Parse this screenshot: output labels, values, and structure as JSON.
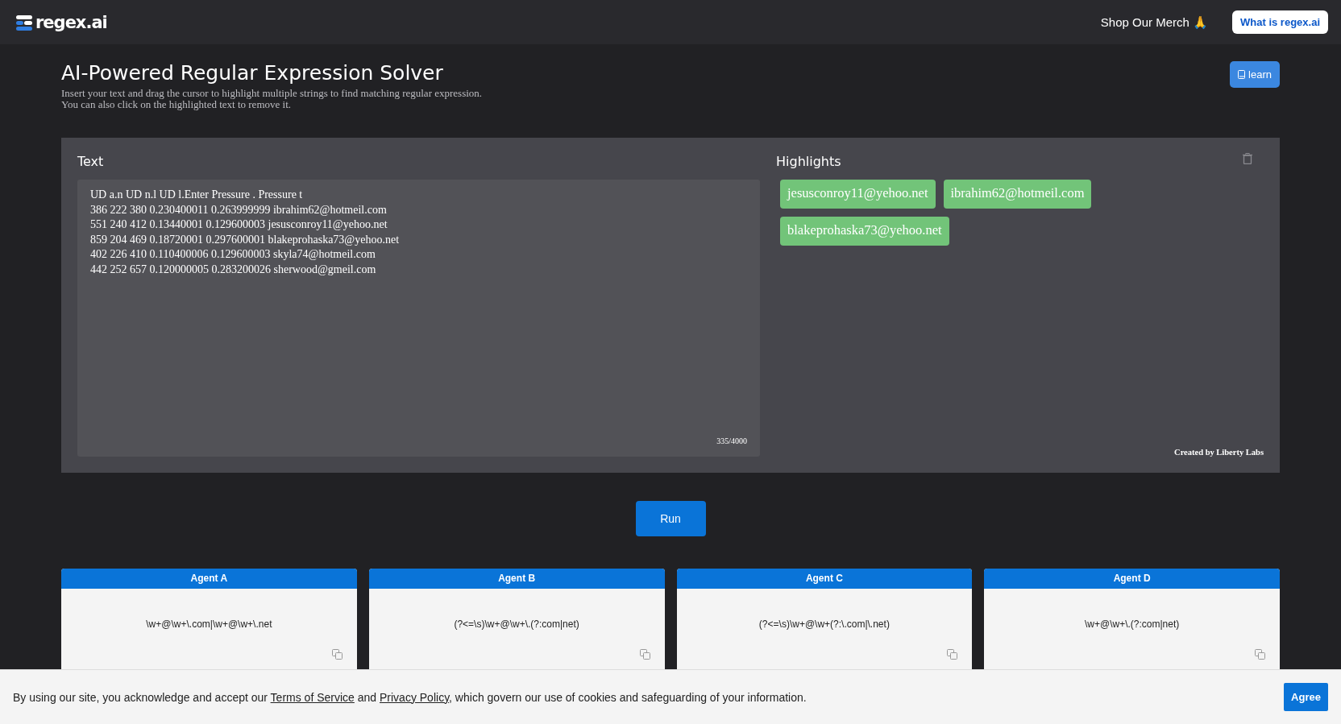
{
  "header": {
    "logo": "regex.ai",
    "merch_link": "Shop Our Merch 🙏",
    "about_button": "What is regex.ai"
  },
  "intro": {
    "title": "AI-Powered Regular Expression Solver",
    "description": [
      "Insert your text and drag the cursor to highlight multiple strings to find matching regular expression.",
      "You can also click on the highlighted text to remove it."
    ],
    "learn_button": "learn"
  },
  "text_panel": {
    "label": "Text",
    "value": "UD a.n UD n.l UD l.Enter Pressure . Pressure t\n386 222 380 0.230400011 0.263999999 ibrahim62@hotmeil.com\n551 240 412 0.13440001 0.129600003 jesusconroy11@yehoo.net\n859 204 469 0.18720001 0.297600001 blakeprohaska73@yehoo.net\n402 226 410 0.110400006 0.129600003 skyla74@hotmeil.com\n442 252 657 0.120000005 0.283200026 sherwood@gmeil.com",
    "counter": "335/4000"
  },
  "highlights_panel": {
    "label": "Highlights",
    "chips": [
      "jesusconroy11@yehoo.net",
      "ibrahim62@hotmeil.com",
      "blakeprohaska73@yehoo.net"
    ],
    "credit": "Created by Liberty Labs"
  },
  "run_button": "Run",
  "agents": [
    {
      "name": "Agent A",
      "regex": "\\w+@\\w+\\.com|\\w+@\\w+\\.net"
    },
    {
      "name": "Agent B",
      "regex": "(?<=\\s)\\w+@\\w+\\.(?:com|net)"
    },
    {
      "name": "Agent C",
      "regex": "(?<=\\s)\\w+@\\w+(?:\\.com|\\.net)"
    },
    {
      "name": "Agent D",
      "regex": "\\w+@\\w+\\.(?:com|net)"
    }
  ],
  "cookie_banner": {
    "text_before": "By using our site, you acknowledge and accept our",
    "terms_link": "Terms of Service",
    "text_middle": "and",
    "privacy_link": "Privacy Policy",
    "text_after": ", which govern our use of cookies and safeguarding of your information.",
    "agree_button": "Agree"
  }
}
